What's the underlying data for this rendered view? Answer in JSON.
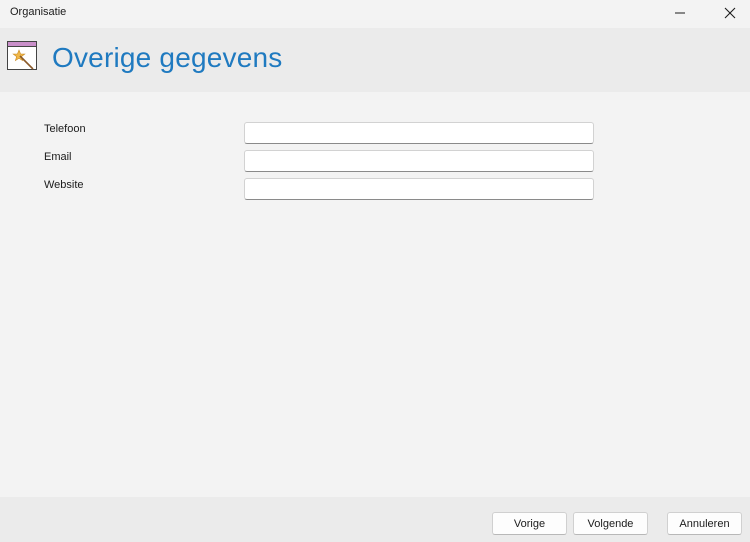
{
  "window": {
    "title": "Organisatie",
    "minimize_icon": "minimize-icon",
    "close_icon": "close-icon"
  },
  "header": {
    "icon": "wizard-icon",
    "title": "Overige gegevens",
    "accent_color": "#1f7ac0"
  },
  "form": {
    "fields": [
      {
        "label": "Telefoon",
        "value": ""
      },
      {
        "label": "Email",
        "value": ""
      },
      {
        "label": "Website",
        "value": ""
      }
    ]
  },
  "footer": {
    "prev_label": "Vorige",
    "next_label": "Volgende",
    "cancel_label": "Annuleren"
  }
}
